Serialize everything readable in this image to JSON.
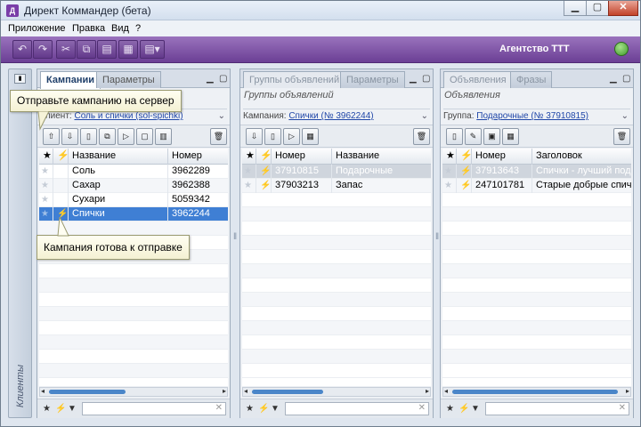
{
  "window": {
    "title": "Директ Коммандер (бета)",
    "app_icon": "direct-commander-icon"
  },
  "menu": [
    "Приложение",
    "Правка",
    "Вид",
    "?"
  ],
  "toolbar": {
    "undo": "↶",
    "redo": "↷",
    "cut": "✂",
    "copy": "⧉",
    "paste": "▤",
    "view": "▦",
    "layout": "▤▾",
    "agency": "Агентство ТТТ"
  },
  "side": {
    "label": "Клиенты"
  },
  "campaigns": {
    "tabs": [
      "Кампании",
      "Параметры"
    ],
    "client_label": "Клиент:",
    "client_value": "Соль и спички (sol-spichki)",
    "columns": {
      "name": "Название",
      "number": "Номер"
    },
    "rows": [
      {
        "name": "Соль",
        "number": "3962289",
        "star": "★",
        "bolt": ""
      },
      {
        "name": "Сахар",
        "number": "3962388",
        "star": "★",
        "bolt": ""
      },
      {
        "name": "Сухари",
        "number": "5059342",
        "star": "★",
        "bolt": ""
      },
      {
        "name": "Спички",
        "number": "3962244",
        "star": "★",
        "bolt": "⚡"
      }
    ]
  },
  "groups": {
    "tabs": [
      "Группы объявлений",
      "Параметры"
    ],
    "subtitle": "Группы объявлений",
    "campaign_label": "Кампания:",
    "campaign_value": "Спички (№ 3962244)",
    "columns": {
      "number": "Номер",
      "name": "Название"
    },
    "rows": [
      {
        "number": "37910815",
        "name": "Подарочные",
        "star": "★",
        "bolt": "⚡"
      },
      {
        "number": "37903213",
        "name": "Запас",
        "star": "★",
        "bolt": "⚡"
      }
    ]
  },
  "ads": {
    "tabs": [
      "Объявления",
      "Фразы"
    ],
    "subtitle": "Объявления",
    "group_label": "Группа:",
    "group_value": "Подарочные (№ 37910815)",
    "columns": {
      "number": "Номер",
      "title": "Заголовок"
    },
    "rows": [
      {
        "number": "37913643",
        "title": "Спички - лучший подар",
        "star": "★",
        "bolt": "⚡"
      },
      {
        "number": "247101781",
        "title": "Старые добрые спичк",
        "star": "★",
        "bolt": "⚡"
      }
    ]
  },
  "tooltips": {
    "send": "Отправьте кампанию на сервер",
    "ready": "Кампания готова к отправке"
  },
  "colors": {
    "toolbar": "#7b52a3",
    "selection": "#3f7fd4",
    "bolt": "#e08a10"
  }
}
